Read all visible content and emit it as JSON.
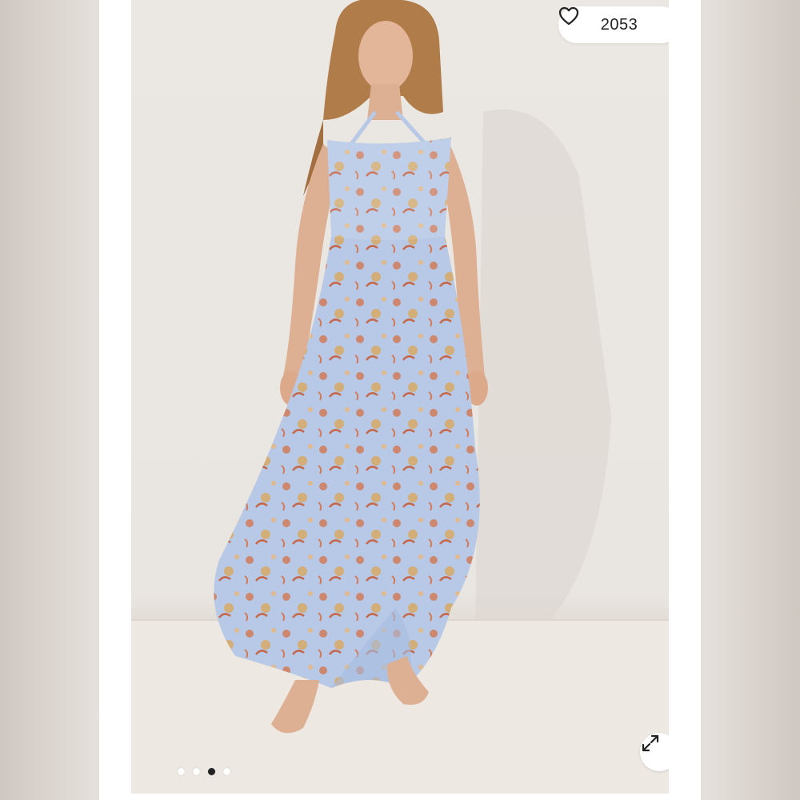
{
  "listing": {
    "like_count": "2053",
    "image_count": 4,
    "active_image_index": 2
  },
  "icons": {
    "like": "heart-outline-icon",
    "expand": "expand-arrows-icon"
  },
  "colors": {
    "dress_base": "#b7c9e6",
    "print_accent": "#d17b5b",
    "print_secondary": "#d9a85c",
    "active_dot": "#222222"
  }
}
